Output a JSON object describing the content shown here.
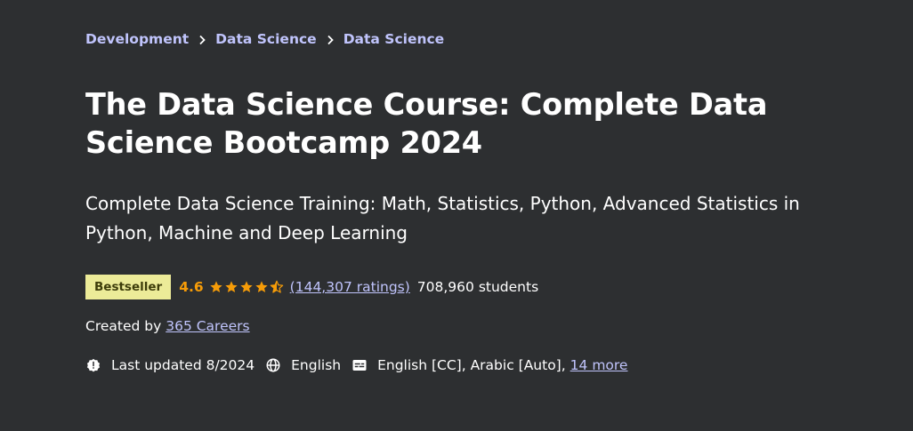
{
  "breadcrumb": {
    "items": [
      "Development",
      "Data Science",
      "Data Science"
    ]
  },
  "course": {
    "title": "The Data Science Course: Complete Data Science Bootcamp 2024",
    "subtitle": "Complete Data Science Training: Math, Statistics, Python, Advanced Statistics in Python, Machine and Deep Learning",
    "badge": "Bestseller",
    "rating": "4.6",
    "stars_value": 4.5,
    "ratings_count": "(144,307 ratings)",
    "students": "708,960 students",
    "created_by_label": "Created by",
    "instructor": "365 Careers",
    "last_updated": "Last updated 8/2024",
    "language": "English",
    "captions": "English [CC], Arabic [Auto],",
    "more_captions": "14 more"
  },
  "colors": {
    "background": "#2d2f31",
    "link": "#c0c4fc",
    "rating": "#f69c08",
    "badge_bg": "#eceb98",
    "badge_text": "#3d3c0a"
  },
  "icons": {
    "breadcrumb_separator": "chevron-right-icon",
    "star": "star-icon",
    "updated": "alert-badge-icon",
    "language": "globe-icon",
    "captions": "closed-captions-icon"
  }
}
